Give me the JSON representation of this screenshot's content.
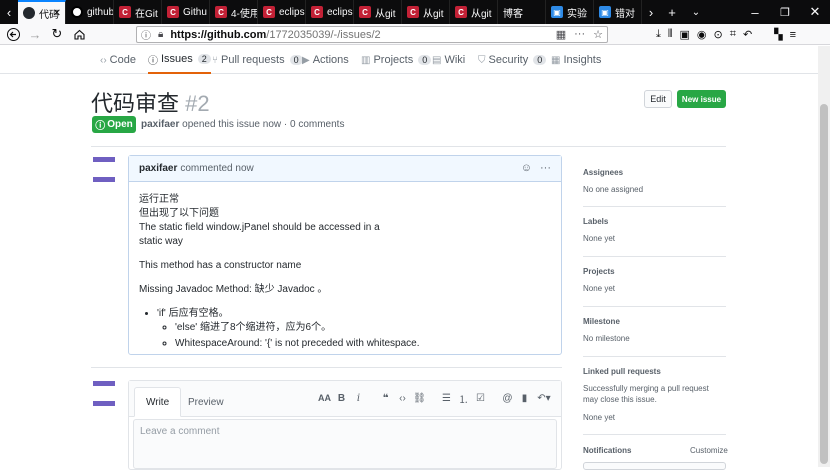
{
  "tabs": [
    {
      "label": "代码",
      "favicon": "github-icon",
      "active": true
    },
    {
      "label": "github",
      "favicon": "github-icon",
      "active": false
    },
    {
      "label": "在Git",
      "favicon": "csdn-icon",
      "active": false
    },
    {
      "label": "Githu",
      "favicon": "csdn-icon",
      "active": false
    },
    {
      "label": "4-使用",
      "favicon": "csdn-icon",
      "active": false
    },
    {
      "label": "eclips",
      "favicon": "csdn-icon",
      "active": false
    },
    {
      "label": "eclips",
      "favicon": "csdn-icon",
      "active": false
    },
    {
      "label": "从git",
      "favicon": "csdn-icon",
      "active": false
    },
    {
      "label": "从git",
      "favicon": "csdn-icon",
      "active": false
    },
    {
      "label": "从git",
      "favicon": "csdn-icon",
      "active": false
    },
    {
      "label": "博客",
      "favicon": "none",
      "active": false
    },
    {
      "label": "实验",
      "favicon": "blue-icon",
      "active": false
    },
    {
      "label": "错对",
      "favicon": "blue-icon",
      "active": false
    }
  ],
  "browser": {
    "url_host": "https://github.com",
    "url_path": "/1772035039/-/issues/2"
  },
  "repo_nav": {
    "code": "Code",
    "issues": "Issues",
    "issues_count": "2",
    "pull_requests": "Pull requests",
    "pull_requests_count": "0",
    "actions": "Actions",
    "projects": "Projects",
    "projects_count": "0",
    "wiki": "Wiki",
    "security": "Security",
    "security_count": "0",
    "insights": "Insights"
  },
  "issue": {
    "title": "代码审查",
    "number": "#2",
    "state": "Open",
    "author": "paxifaer",
    "meta": "opened this issue now · 0 comments",
    "edit_label": "Edit",
    "new_issue_label": "New issue"
  },
  "comment": {
    "author": "paxifaer",
    "time": "commented now",
    "lines": [
      "运行正常",
      "但出现了以下问题",
      "The static field window.jPanel should be accessed in a",
      "static way"
    ],
    "p2": "This method has a constructor name",
    "p3": "Missing Javadoc Method: 缺少 Javadoc 。",
    "li1": "'if' 后应有空格。",
    "li1a": "'else' 缩进了8个缩进符，应为6个。",
    "li1b": "WhitespaceAround: '{' is not preceded with whitespace."
  },
  "editor": {
    "write_tab": "Write",
    "preview_tab": "Preview",
    "placeholder": "Leave a comment"
  },
  "sidebar": {
    "assignees": "Assignees",
    "assignees_value": "No one assigned",
    "labels": "Labels",
    "labels_value": "None yet",
    "projects": "Projects",
    "projects_value": "None yet",
    "milestone": "Milestone",
    "milestone_value": "No milestone",
    "linked": "Linked pull requests",
    "linked_desc": "Successfully merging a pull request may close this issue.",
    "linked_value": "None yet",
    "notifications": "Notifications",
    "customize": "Customize"
  }
}
